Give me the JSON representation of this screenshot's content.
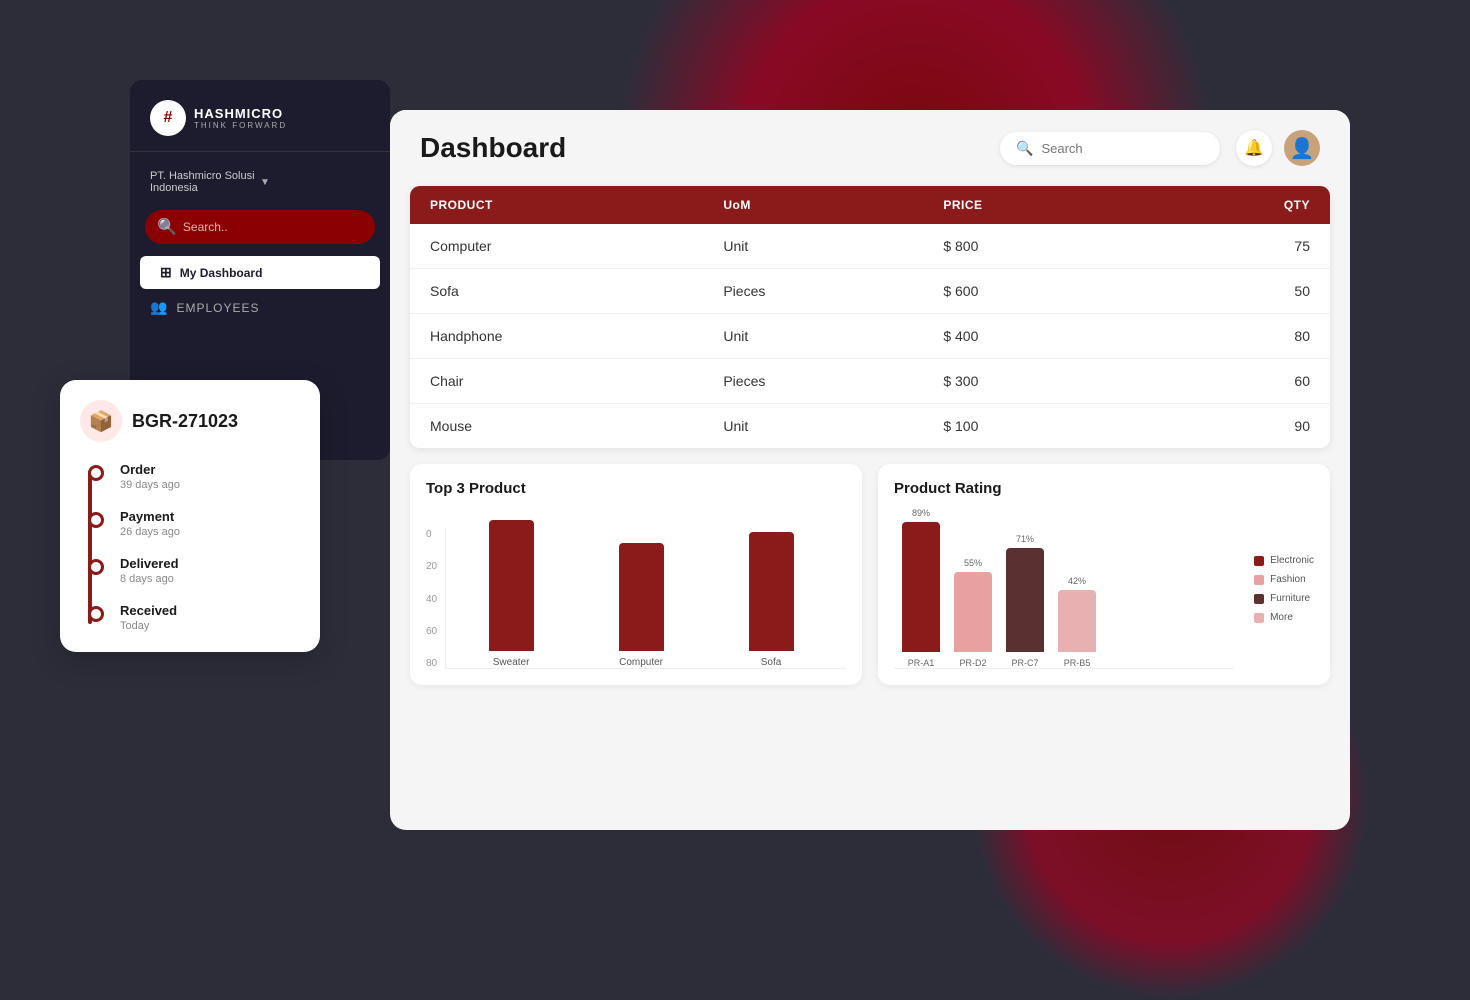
{
  "app": {
    "title": "Dashboard",
    "bg_color": "#2d2d3a"
  },
  "sidebar": {
    "logo_text": "HASHMICRO",
    "logo_sub": "THINK FORWARD",
    "company": "PT. Hashmicro Solusi Indonesia",
    "search_placeholder": "Search..",
    "nav_items": [
      {
        "label": "My Dashboard",
        "active": true
      },
      {
        "label": "EMPLOYEES",
        "active": false
      }
    ]
  },
  "header": {
    "title": "Dashboard",
    "search_placeholder": "Search"
  },
  "table": {
    "headers": [
      "PRODUCT",
      "UoM",
      "PRICE",
      "QTY"
    ],
    "rows": [
      {
        "product": "Computer",
        "uom": "Unit",
        "price": "$ 800",
        "qty": "75"
      },
      {
        "product": "Sofa",
        "uom": "Pieces",
        "price": "$ 600",
        "qty": "50"
      },
      {
        "product": "Handphone",
        "uom": "Unit",
        "price": "$ 400",
        "qty": "80"
      },
      {
        "product": "Chair",
        "uom": "Pieces",
        "price": "$ 300",
        "qty": "60"
      },
      {
        "product": "Mouse",
        "uom": "Unit",
        "price": "$ 100",
        "qty": "90"
      }
    ]
  },
  "top3_chart": {
    "title": "Top 3 Product",
    "y_labels": [
      "0",
      "20",
      "40",
      "60",
      "80"
    ],
    "bars": [
      {
        "label": "Sweater",
        "value": 75,
        "color": "#8b1a1a"
      },
      {
        "label": "Computer",
        "value": 62,
        "color": "#8b1a1a"
      },
      {
        "label": "Sofa",
        "value": 68,
        "color": "#8b1a1a"
      }
    ]
  },
  "rating_chart": {
    "title": "Product Rating",
    "bars": [
      {
        "label": "PR-A1",
        "pct": "89%",
        "value": 89,
        "color": "#8b1a1a"
      },
      {
        "label": "PR-D2",
        "pct": "55%",
        "value": 55,
        "color": "#e8a0a0"
      },
      {
        "label": "PR-C7",
        "pct": "71%",
        "value": 71,
        "color": "#5a3030"
      },
      {
        "label": "PR-B5",
        "pct": "42%",
        "value": 42,
        "color": "#e8b0b0"
      }
    ],
    "legend": [
      {
        "label": "Electronic",
        "color": "#8b1a1a"
      },
      {
        "label": "Fashion",
        "color": "#e8a0a0"
      },
      {
        "label": "Furniture",
        "color": "#5a3030"
      },
      {
        "label": "More",
        "color": "#e8b0b0"
      }
    ]
  },
  "order_card": {
    "id": "BGR-271023",
    "icon": "📦",
    "steps": [
      {
        "title": "Order",
        "time": "39 days ago"
      },
      {
        "title": "Payment",
        "time": "26 days ago"
      },
      {
        "title": "Delivered",
        "time": "8 days ago"
      },
      {
        "title": "Received",
        "time": "Today"
      }
    ]
  }
}
